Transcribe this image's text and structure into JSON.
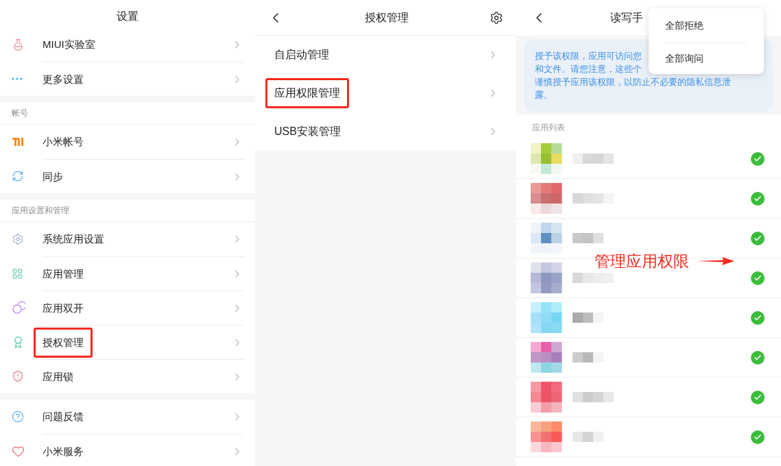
{
  "settings_screen": {
    "title": "设置",
    "sections": [
      {
        "items": [
          {
            "label": "MIUI实验室",
            "highlighted": false
          },
          {
            "label": "更多设置",
            "highlighted": false
          }
        ]
      },
      {
        "header": "帐号",
        "items": [
          {
            "label": "小米帐号",
            "highlighted": false
          },
          {
            "label": "同步",
            "highlighted": false
          }
        ]
      },
      {
        "header": "应用设置和管理",
        "items": [
          {
            "label": "系统应用设置",
            "highlighted": false
          },
          {
            "label": "应用管理",
            "highlighted": false
          },
          {
            "label": "应用双开",
            "highlighted": false
          },
          {
            "label": "授权管理",
            "highlighted": true
          },
          {
            "label": "应用锁",
            "highlighted": false
          }
        ]
      },
      {
        "items": [
          {
            "label": "问题反馈",
            "highlighted": false
          },
          {
            "label": "小米服务",
            "highlighted": false
          }
        ]
      }
    ]
  },
  "authorization_screen": {
    "title": "授权管理",
    "items": [
      {
        "label": "自启动管理",
        "highlighted": false
      },
      {
        "label": "应用权限管理",
        "highlighted": true
      },
      {
        "label": "USB安装管理",
        "highlighted": false
      }
    ]
  },
  "permission_screen": {
    "title": "读写手",
    "info_lines": [
      "授予该权限，应用可访问您",
      "和文件。请您注意，这些个",
      "谨慎授予应用该权限，以防止不必要的隐私信息泄",
      "露。"
    ],
    "list_header": "应用列表",
    "apps": [
      {
        "granted": true
      },
      {
        "granted": true
      },
      {
        "granted": true
      },
      {
        "granted": true
      },
      {
        "granted": true
      },
      {
        "granted": true
      },
      {
        "granted": true
      },
      {
        "granted": true
      }
    ],
    "menu": [
      "全部拒绝",
      "全部询问"
    ]
  },
  "annotation": {
    "text": "管理应用权限"
  }
}
